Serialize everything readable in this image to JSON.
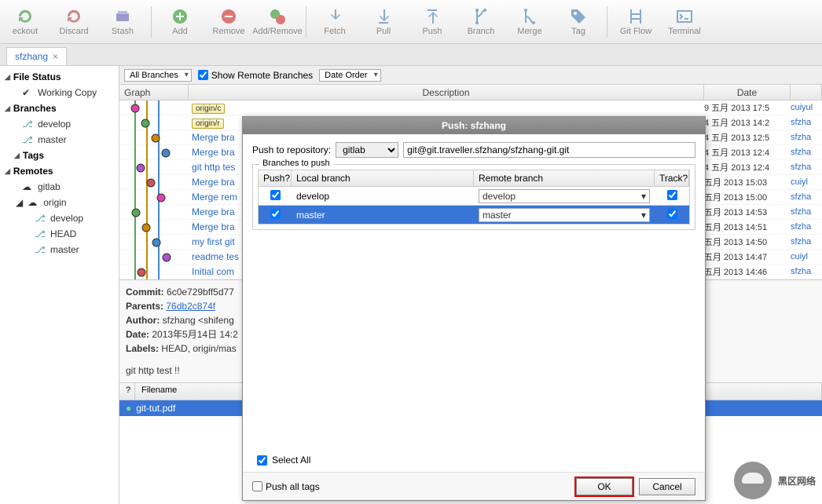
{
  "toolbar": {
    "checkout": "eckout",
    "discard": "Discard",
    "stash": "Stash",
    "add": "Add",
    "remove": "Remove",
    "addremove": "Add/Remove",
    "fetch": "Fetch",
    "pull": "Pull",
    "push": "Push",
    "branch": "Branch",
    "merge": "Merge",
    "tag": "Tag",
    "gitflow": "Git Flow",
    "terminal": "Terminal"
  },
  "tab": {
    "name": "sfzhang"
  },
  "sidebar": {
    "file_status": "File Status",
    "working_copy": "Working Copy",
    "branches": "Branches",
    "develop": "develop",
    "master": "master",
    "tags": "Tags",
    "remotes": "Remotes",
    "gitlab": "gitlab",
    "origin": "origin",
    "o_develop": "develop",
    "o_head": "HEAD",
    "o_master": "master"
  },
  "filters": {
    "all_branches": "All Branches",
    "show_remote": "Show Remote Branches",
    "date_order": "Date Order"
  },
  "columns": {
    "graph": "Graph",
    "description": "Description",
    "date": "Date"
  },
  "commits": [
    {
      "badge": "origin/c",
      "desc": "",
      "date": "9 五月 2013 17:5",
      "author": "cuiyul"
    },
    {
      "badge": "origin/r",
      "desc": "",
      "date": "4 五月 2013 14:2",
      "author": "sfzha"
    },
    {
      "badge": "",
      "desc": "Merge bra",
      "date": "4 五月 2013 12:5",
      "author": "sfzha"
    },
    {
      "badge": "",
      "desc": "Merge bra",
      "date": "4 五月 2013 12:4",
      "author": "sfzha"
    },
    {
      "badge": "",
      "desc": "git http tes",
      "date": "4 五月 2013 12:4",
      "author": "sfzha"
    },
    {
      "badge": "",
      "desc": "Merge bra",
      "date": "五月 2013 15:03",
      "author": "cuiyl"
    },
    {
      "badge": "",
      "desc": "Merge rem",
      "date": "五月 2013 15:00",
      "author": "sfzha"
    },
    {
      "badge": "",
      "desc": "Merge bra",
      "date": "五月 2013 14:53",
      "author": "sfzha"
    },
    {
      "badge": "",
      "desc": "Merge bra",
      "date": "五月 2013 14:51",
      "author": "sfzha"
    },
    {
      "badge": "",
      "desc": "my first git",
      "date": "五月 2013 14:50",
      "author": "sfzha"
    },
    {
      "badge": "",
      "desc": "readme tes",
      "date": "五月 2013 14:47",
      "author": "cuiyl"
    },
    {
      "badge": "",
      "desc": "Initial com",
      "date": "五月 2013 14:46",
      "author": "sfzha"
    }
  ],
  "details": {
    "commit_lbl": "Commit:",
    "commit": "6c0e729bff5d77",
    "parents_lbl": "Parents:",
    "parents": "76db2c874f",
    "author_lbl": "Author:",
    "author": "sfzhang <shifeng",
    "date_lbl": "Date:",
    "date": "2013年5月14日 14:2",
    "labels_lbl": "Labels:",
    "labels": "HEAD, origin/mas",
    "msg": "git http test !!"
  },
  "files": {
    "q": "?",
    "filename": "Filename",
    "file": "git-tut.pdf"
  },
  "dialog": {
    "title": "Push: sfzhang",
    "push_to": "Push to repository:",
    "remote": "gitlab",
    "url_pre": "git@",
    "url_strike": "git.traveller.",
    "url_post": "sfzhang/sfzhang-git.git",
    "branches_to_push": "Branches to push",
    "hdr_push": "Push?",
    "hdr_local": "Local branch",
    "hdr_remote": "Remote branch",
    "hdr_track": "Track?",
    "row1_local": "develop",
    "row1_remote": "develop",
    "row2_local": "master",
    "row2_remote": "master",
    "select_all": "Select All",
    "push_all_tags": "Push all tags",
    "ok": "OK",
    "cancel": "Cancel"
  },
  "watermark": "黑区网络"
}
